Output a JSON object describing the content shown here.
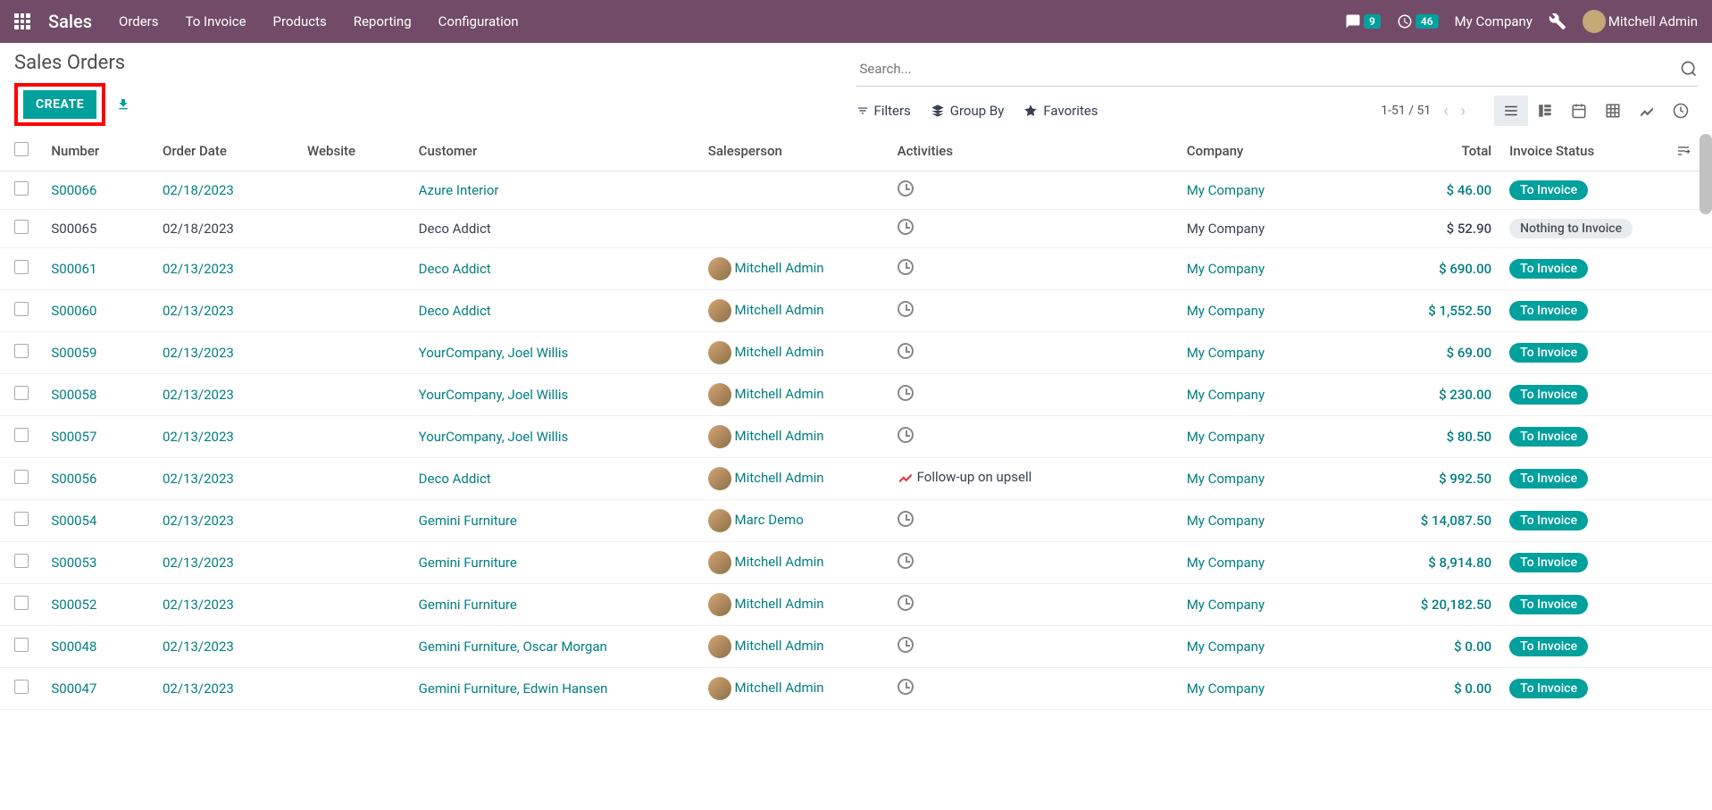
{
  "topbar": {
    "brand": "Sales",
    "menu": [
      "Orders",
      "To Invoice",
      "Products",
      "Reporting",
      "Configuration"
    ],
    "messages_badge": "9",
    "activities_badge": "46",
    "company": "My Company",
    "user": "Mitchell Admin"
  },
  "page": {
    "title": "Sales Orders",
    "create_label": "CREATE",
    "search_placeholder": "Search...",
    "filters_label": "Filters",
    "groupby_label": "Group By",
    "favorites_label": "Favorites",
    "pager": "1-51 / 51"
  },
  "columns": {
    "number": "Number",
    "date": "Order Date",
    "website": "Website",
    "customer": "Customer",
    "salesperson": "Salesperson",
    "activities": "Activities",
    "company": "Company",
    "total": "Total",
    "status": "Invoice Status"
  },
  "rows": [
    {
      "number": "S00066",
      "date": "02/18/2023",
      "customer": "Azure Interior",
      "salesperson": "",
      "activity": "",
      "company": "My Company",
      "total": "$ 46.00",
      "status": "To Invoice",
      "linked": true,
      "clock": true
    },
    {
      "number": "S00065",
      "date": "02/18/2023",
      "customer": "Deco Addict",
      "salesperson": "",
      "activity": "",
      "company": "My Company",
      "total": "$ 52.90",
      "status": "Nothing to Invoice",
      "linked": false,
      "clock": true
    },
    {
      "number": "S00061",
      "date": "02/13/2023",
      "customer": "Deco Addict",
      "salesperson": "Mitchell Admin",
      "activity": "",
      "company": "My Company",
      "total": "$ 690.00",
      "status": "To Invoice",
      "linked": true,
      "clock": true
    },
    {
      "number": "S00060",
      "date": "02/13/2023",
      "customer": "Deco Addict",
      "salesperson": "Mitchell Admin",
      "activity": "",
      "company": "My Company",
      "total": "$ 1,552.50",
      "status": "To Invoice",
      "linked": true,
      "clock": true
    },
    {
      "number": "S00059",
      "date": "02/13/2023",
      "customer": "YourCompany, Joel Willis",
      "salesperson": "Mitchell Admin",
      "activity": "",
      "company": "My Company",
      "total": "$ 69.00",
      "status": "To Invoice",
      "linked": true,
      "clock": true
    },
    {
      "number": "S00058",
      "date": "02/13/2023",
      "customer": "YourCompany, Joel Willis",
      "salesperson": "Mitchell Admin",
      "activity": "",
      "company": "My Company",
      "total": "$ 230.00",
      "status": "To Invoice",
      "linked": true,
      "clock": true
    },
    {
      "number": "S00057",
      "date": "02/13/2023",
      "customer": "YourCompany, Joel Willis",
      "salesperson": "Mitchell Admin",
      "activity": "",
      "company": "My Company",
      "total": "$ 80.50",
      "status": "To Invoice",
      "linked": true,
      "clock": true
    },
    {
      "number": "S00056",
      "date": "02/13/2023",
      "customer": "Deco Addict",
      "salesperson": "Mitchell Admin",
      "activity": "Follow-up on upsell",
      "company": "My Company",
      "total": "$ 992.50",
      "status": "To Invoice",
      "linked": true,
      "clock": false
    },
    {
      "number": "S00054",
      "date": "02/13/2023",
      "customer": "Gemini Furniture",
      "salesperson": "Marc Demo",
      "activity": "",
      "company": "My Company",
      "total": "$ 14,087.50",
      "status": "To Invoice",
      "linked": true,
      "clock": true
    },
    {
      "number": "S00053",
      "date": "02/13/2023",
      "customer": "Gemini Furniture",
      "salesperson": "Mitchell Admin",
      "activity": "",
      "company": "My Company",
      "total": "$ 8,914.80",
      "status": "To Invoice",
      "linked": true,
      "clock": true
    },
    {
      "number": "S00052",
      "date": "02/13/2023",
      "customer": "Gemini Furniture",
      "salesperson": "Mitchell Admin",
      "activity": "",
      "company": "My Company",
      "total": "$ 20,182.50",
      "status": "To Invoice",
      "linked": true,
      "clock": true
    },
    {
      "number": "S00048",
      "date": "02/13/2023",
      "customer": "Gemini Furniture, Oscar Morgan",
      "salesperson": "Mitchell Admin",
      "activity": "",
      "company": "My Company",
      "total": "$ 0.00",
      "status": "To Invoice",
      "linked": true,
      "clock": true
    },
    {
      "number": "S00047",
      "date": "02/13/2023",
      "customer": "Gemini Furniture, Edwin Hansen",
      "salesperson": "Mitchell Admin",
      "activity": "",
      "company": "My Company",
      "total": "$ 0.00",
      "status": "To Invoice",
      "linked": true,
      "clock": true
    }
  ]
}
